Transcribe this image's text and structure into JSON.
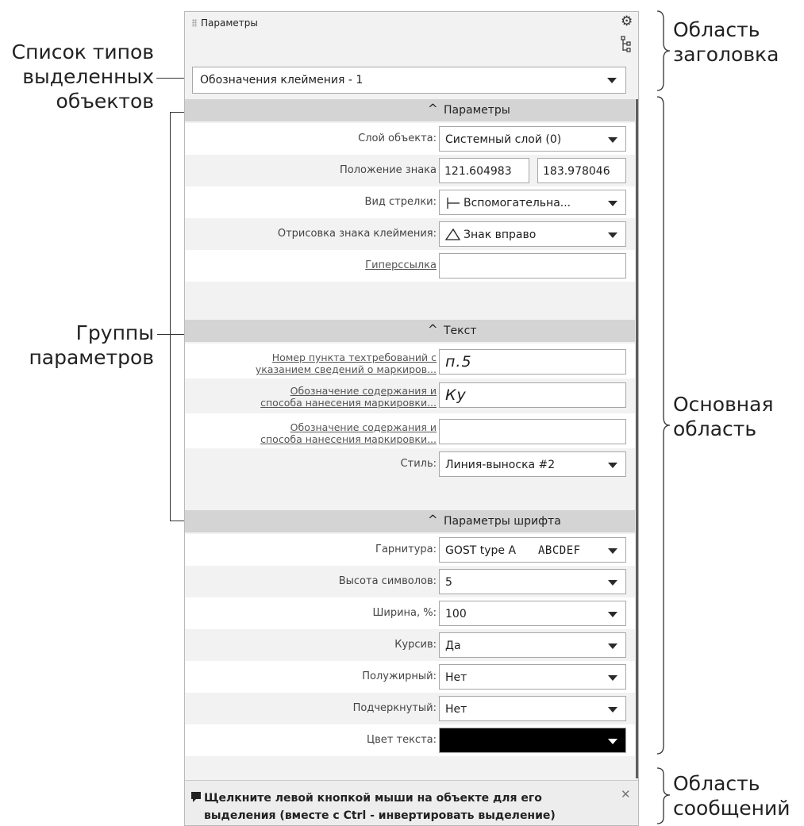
{
  "annotations": {
    "types_list": "Список типов\nвыделенных\nобъектов",
    "groups": "Группы\nпараметров",
    "header_area": "Область\nзаголовка",
    "main_area": "Основная\nобласть",
    "messages_area": "Область\nсообщений"
  },
  "panel": {
    "title": "Параметры",
    "type_select": "Обозначения клеймения - 1"
  },
  "groups": {
    "params": "Параметры",
    "text": "Текст",
    "font": "Параметры шрифта"
  },
  "params": {
    "layer_label": "Слой объекта:",
    "layer_value": "Системный слой (0)",
    "position_label": "Положение знака",
    "position_x": "121.604983",
    "position_y": "183.978046",
    "arrow_label": "Вид стрелки:",
    "arrow_value": "Вспомогательна...",
    "drawing_label": "Отрисовка знака клеймения:",
    "drawing_value": "Знак вправо",
    "hyperlink_label": "Гиперссылка",
    "hyperlink_value": ""
  },
  "text": {
    "item1_label_l1": "Номер пункта техтребований с",
    "item1_label_l2": "указанием сведений о маркиров...",
    "item1_value": "п.5",
    "item2_label_l1": "Обозначение содержания и",
    "item2_label_l2": "способа нанесения маркировки...",
    "item2_value": "Ку",
    "item3_label_l1": "Обозначение содержания и",
    "item3_label_l2": "способа нанесения маркировки...",
    "item3_value": "",
    "style_label": "Стиль:",
    "style_value": "Линия-выноска #2"
  },
  "font": {
    "typeface_label": "Гарнитура:",
    "typeface_value": "GOST type A",
    "typeface_sample": "ABCDEF",
    "height_label": "Высота символов:",
    "height_value": "5",
    "width_label": "Ширина, %:",
    "width_value": "100",
    "italic_label": "Курсив:",
    "italic_value": "Да",
    "bold_label": "Полужирный:",
    "bold_value": "Нет",
    "underline_label": "Подчеркнутый:",
    "underline_value": "Нет",
    "color_label": "Цвет текста:",
    "color_value": "#000000"
  },
  "message": {
    "text": "Щелкните левой кнопкой мыши на объекте для его выделения (вместе с Ctrl - инвертировать выделение)"
  },
  "icons": [
    "gear-icon",
    "tree-icon",
    "chevron-up-icon",
    "dropdown-arrow-icon",
    "message-icon",
    "close-icon",
    "arrow-style-icon",
    "triangle-sign-icon"
  ]
}
